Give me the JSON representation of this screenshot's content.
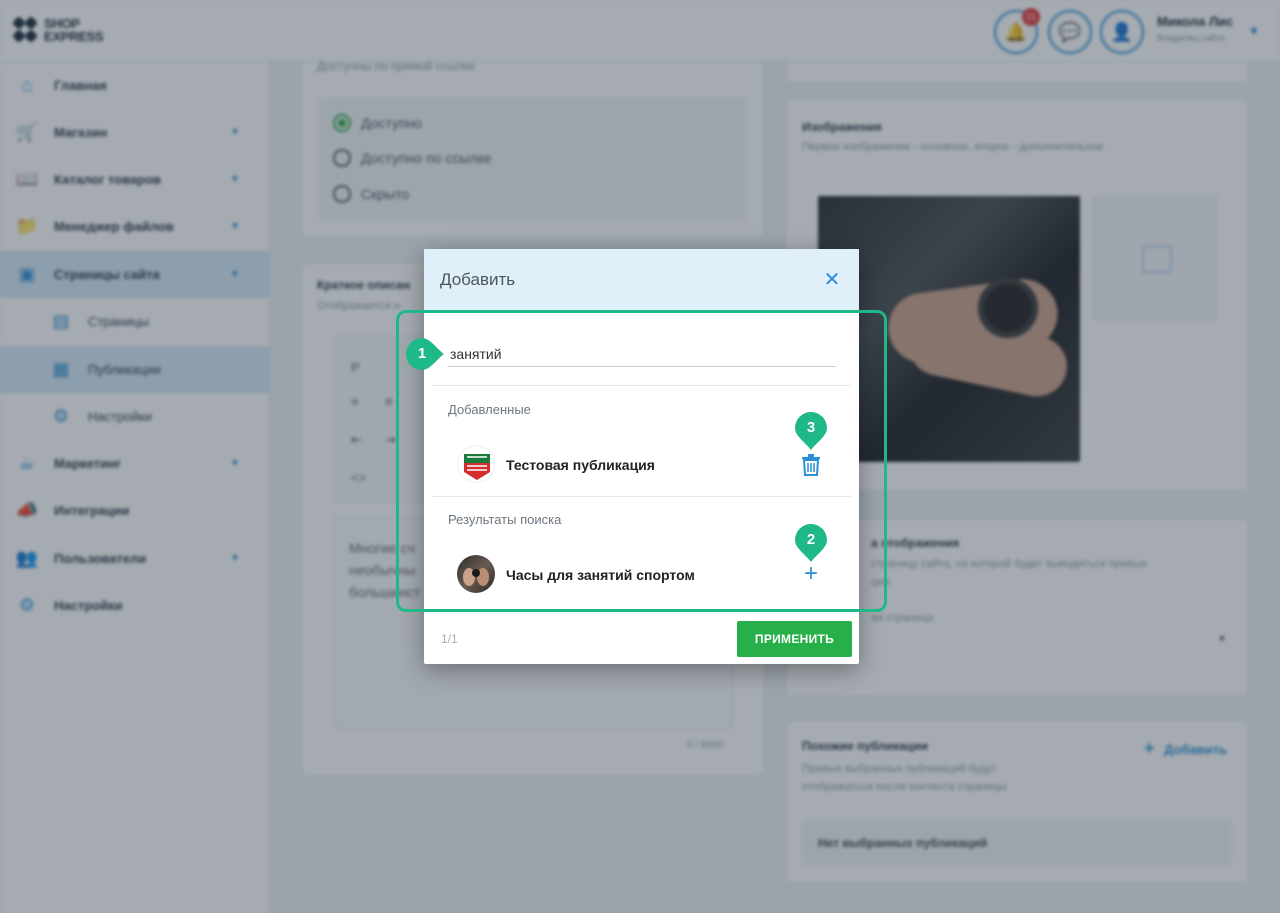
{
  "header": {
    "logo_line1": "SHOP",
    "logo_line2": "EXPRESS",
    "notification_count": "21",
    "user_name": "Микола Лис",
    "user_role": "Владелец сайта"
  },
  "sidebar": {
    "items": [
      {
        "label": "Главная",
        "icon": "home-icon"
      },
      {
        "label": "Магазин",
        "icon": "cart-icon"
      },
      {
        "label": "Каталог товаров",
        "icon": "book-icon"
      },
      {
        "label": "Менеджер файлов",
        "icon": "folder-icon"
      },
      {
        "label": "Страницы сайта",
        "icon": "browser-icon"
      },
      {
        "label": "Страницы",
        "icon": "page-icon"
      },
      {
        "label": "Публикации",
        "icon": "news-icon"
      },
      {
        "label": "Настройки",
        "icon": "gear-icon"
      },
      {
        "label": "Маркетинг",
        "icon": "mug-icon"
      },
      {
        "label": "Интеграции",
        "icon": "megaphone-icon"
      },
      {
        "label": "Пользователи",
        "icon": "users-icon"
      },
      {
        "label": "Настройки",
        "icon": "gear-icon"
      }
    ]
  },
  "background": {
    "availability_hint": "Доступны по прямой ссылке",
    "radio_options": [
      "Доступно",
      "Доступно по ссылке",
      "Скрыто"
    ],
    "short_desc_title": "Краткое описан",
    "short_desc_hint": "Отображается н",
    "editor_placeholder_p": "P",
    "editor_text": [
      "Многие сч",
      "необычны",
      "большинст"
    ],
    "char_counter": "0 / 8000",
    "images_title": "Изображения",
    "images_hint": "Первое изображение - основное, второе - дополнительное",
    "display_title": "а отображения",
    "display_hint1": "страницу сайта, на которой будет выводиться превью",
    "display_hint2": "ции",
    "display_select": "ая страница",
    "similar_title": "Похожие публикации",
    "similar_hint1": "Превью выбранных публикаций будут",
    "similar_hint2": "отображаться после контента страницы",
    "similar_add": "Добавить",
    "similar_empty": "Нет выбранных публикаций"
  },
  "modal": {
    "title": "Добавить",
    "search_value": "занятий",
    "added_label": "Добавленные",
    "added_items": [
      {
        "title": "Тестовая публикация",
        "avatar": "tag-heuer-logo"
      }
    ],
    "results_label": "Результаты поиска",
    "result_items": [
      {
        "title": "Часы для занятий спортом",
        "avatar": "watch-photo"
      }
    ],
    "pager": "1/1",
    "apply_label": "ПРИМЕНИТЬ"
  },
  "annotations": {
    "markers": [
      "1",
      "2",
      "3"
    ],
    "accent_color": "#1fb889"
  }
}
